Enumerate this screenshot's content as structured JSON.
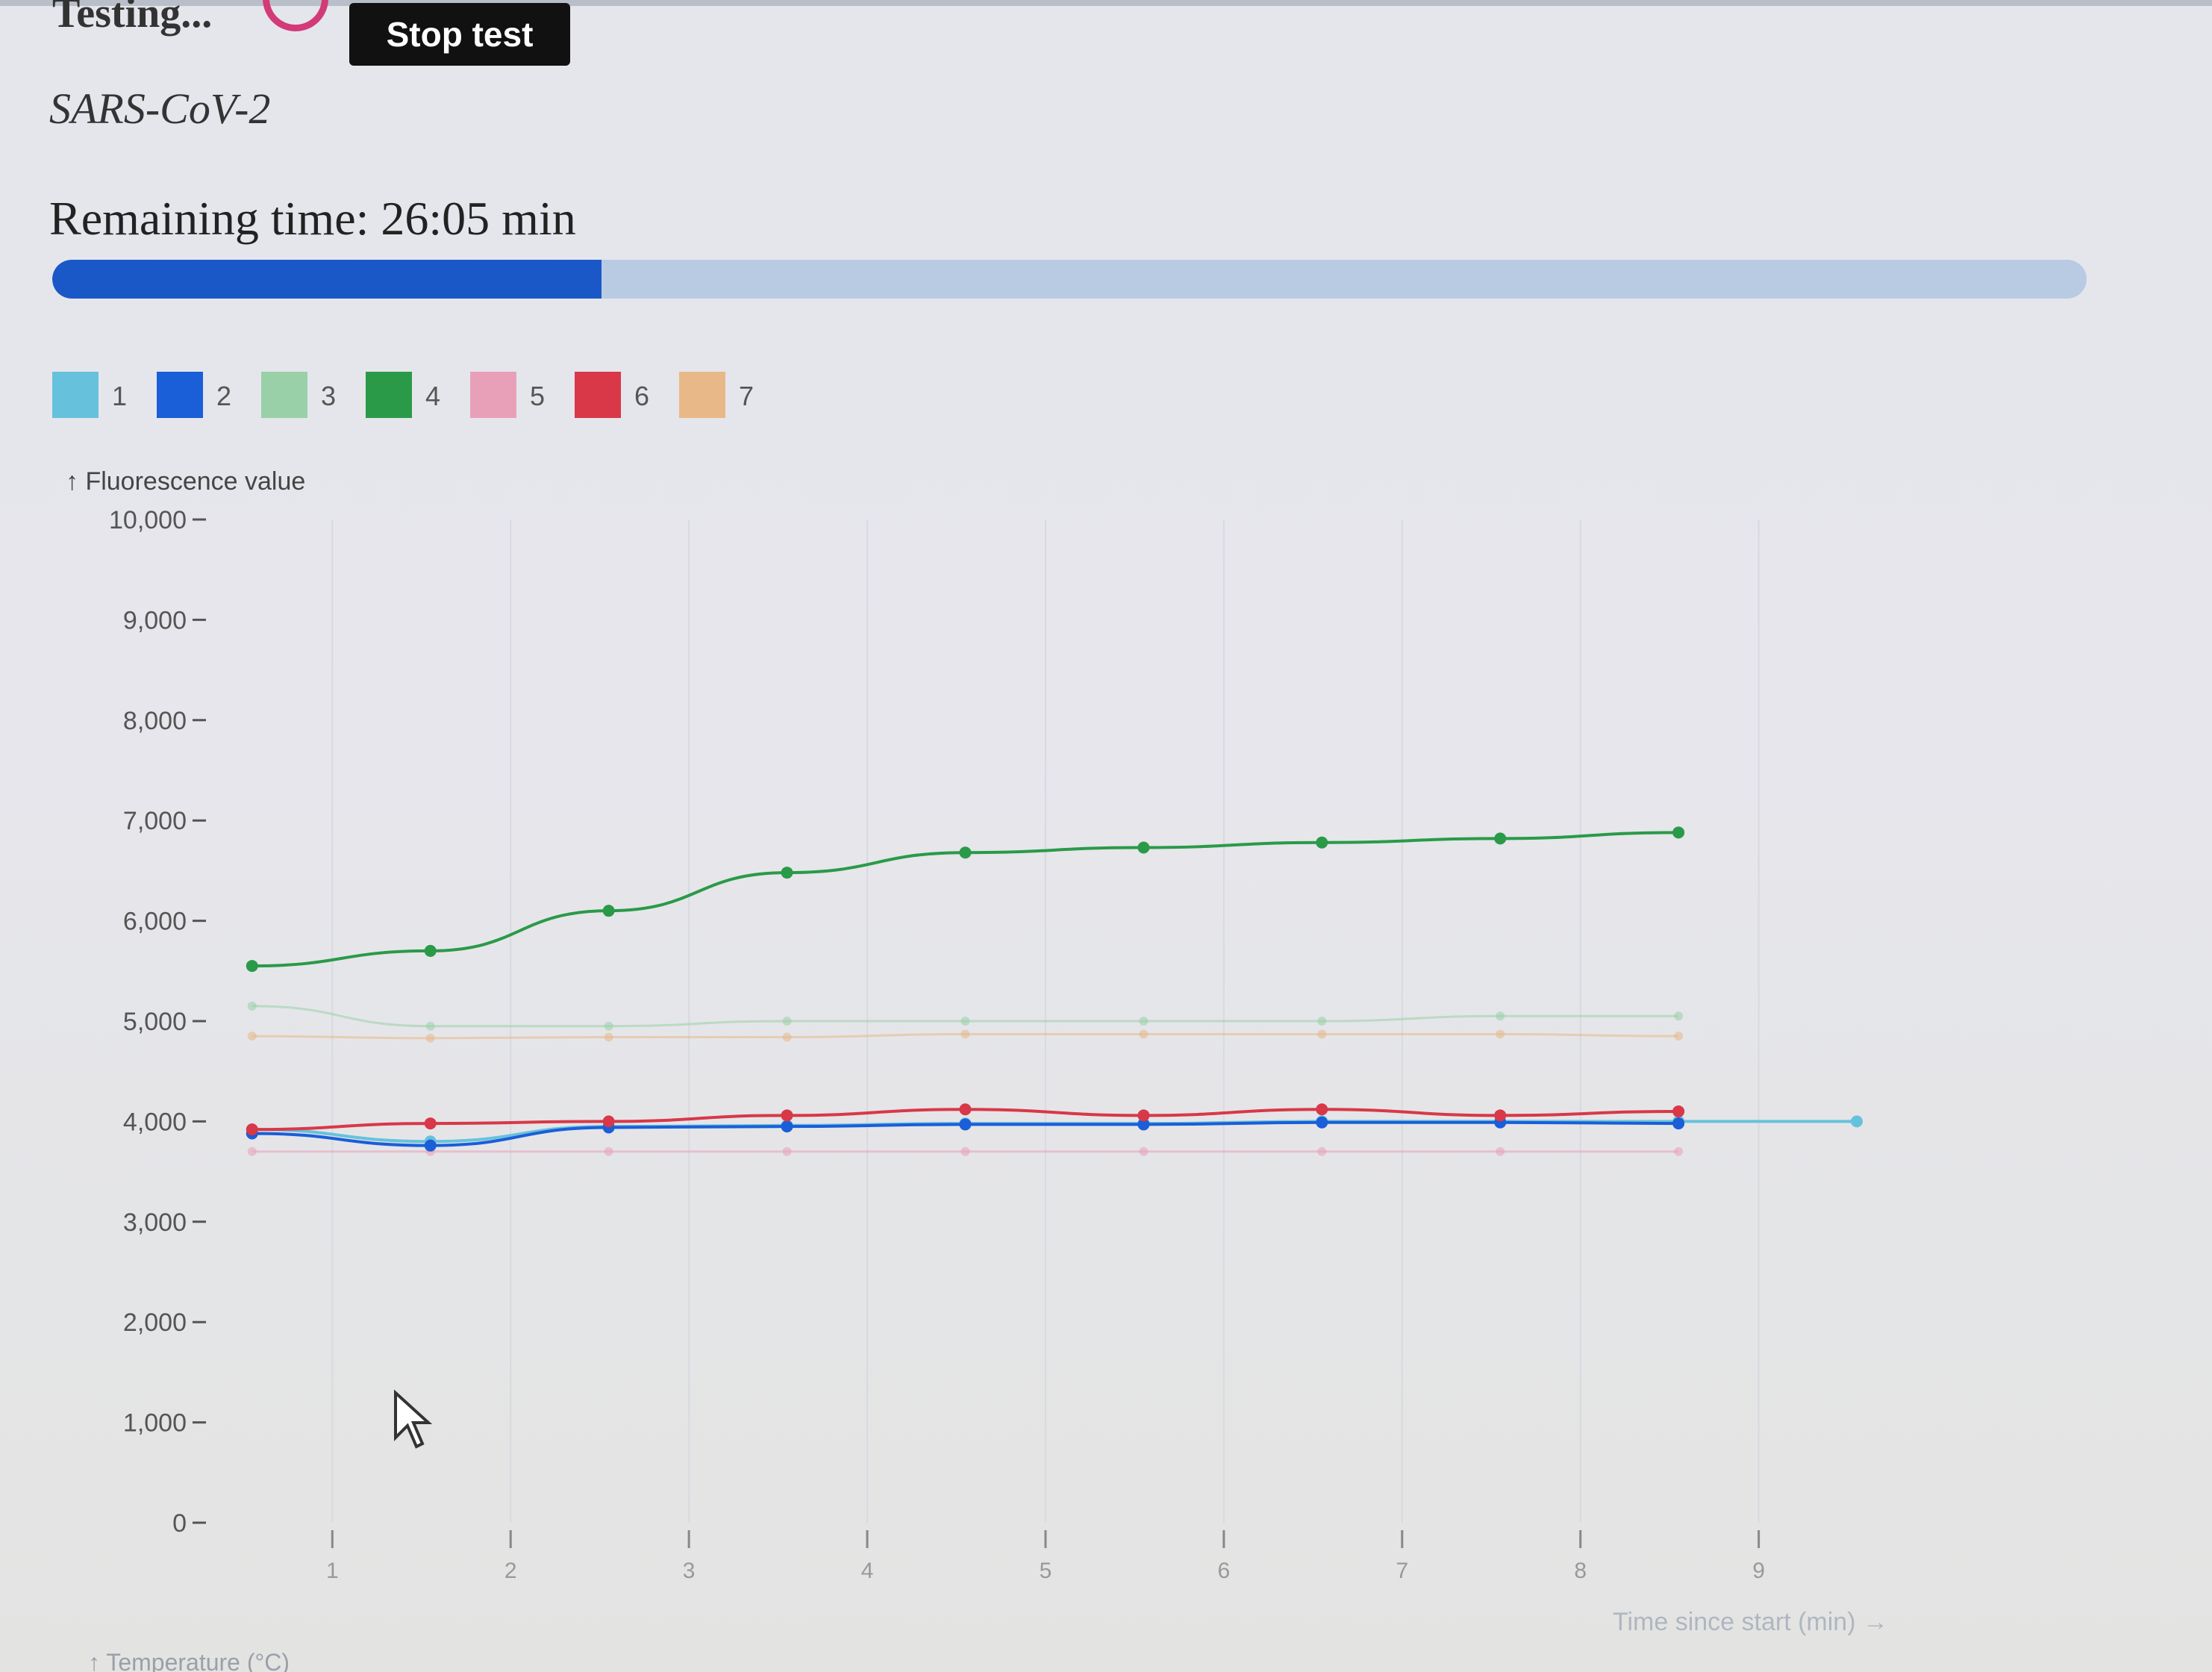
{
  "header": {
    "status_text": "Testing...",
    "stop_button_label": "Stop test"
  },
  "test": {
    "name": "SARS-CoV-2",
    "remaining_label": "Remaining time:",
    "remaining_value": "26:05",
    "remaining_unit": "min",
    "remaining_text": "Remaining time: 26:05 min",
    "progress_fraction": 0.27
  },
  "colors": {
    "progress_fill": "#1a58c8",
    "progress_track": "#b9cbe2"
  },
  "chart_data": {
    "type": "line",
    "title": "",
    "ylabel": "↑ Fluorescence value",
    "xlabel": "Time since start (min) →",
    "secondary_label": "↑ Temperature (°C)",
    "ylim": [
      0,
      10000
    ],
    "yticks": [
      0,
      1000,
      2000,
      3000,
      4000,
      5000,
      6000,
      7000,
      8000,
      9000,
      10000
    ],
    "ytick_labels": [
      "0",
      "1,000",
      "2,000",
      "3,000",
      "4,000",
      "5,000",
      "6,000",
      "7,000",
      "8,000",
      "9,000",
      "10,000"
    ],
    "xlim": [
      0.35,
      9.6
    ],
    "xticks": [
      1,
      2,
      3,
      4,
      5,
      6,
      7,
      8,
      9
    ],
    "xtick_labels": [
      "1",
      "2",
      "3",
      "4",
      "5",
      "6",
      "7",
      "8",
      "9"
    ],
    "grid": "vertical",
    "legend_position": "top-left",
    "series": [
      {
        "name": "1",
        "color": "#66c2dc",
        "faded": false,
        "x": [
          0.55,
          1.55,
          2.55,
          3.55,
          4.55,
          5.55,
          6.55,
          7.55,
          8.55,
          9.55
        ],
        "values": [
          3920,
          3800,
          3950,
          3960,
          3980,
          3980,
          4000,
          4000,
          4000,
          4000
        ]
      },
      {
        "name": "2",
        "color": "#1a5ed8",
        "faded": false,
        "x": [
          0.55,
          1.55,
          2.55,
          3.55,
          4.55,
          5.55,
          6.55,
          7.55,
          8.55
        ],
        "values": [
          3880,
          3760,
          3940,
          3950,
          3970,
          3970,
          3990,
          3990,
          3980
        ]
      },
      {
        "name": "3",
        "color": "#99d0a8",
        "faded": true,
        "x": [
          0.55,
          1.55,
          2.55,
          3.55,
          4.55,
          5.55,
          6.55,
          7.55,
          8.55
        ],
        "values": [
          5150,
          4950,
          4950,
          5000,
          5000,
          5000,
          5000,
          5050,
          5050
        ]
      },
      {
        "name": "4",
        "color": "#2a9a48",
        "faded": false,
        "x": [
          0.55,
          1.55,
          2.55,
          3.55,
          4.55,
          5.55,
          6.55,
          7.55,
          8.55
        ],
        "values": [
          5550,
          5700,
          6100,
          6480,
          6680,
          6730,
          6780,
          6820,
          6880
        ]
      },
      {
        "name": "5",
        "color": "#e8a0b8",
        "faded": true,
        "x": [
          0.55,
          1.55,
          2.55,
          3.55,
          4.55,
          5.55,
          6.55,
          7.55,
          8.55
        ],
        "values": [
          3700,
          3700,
          3700,
          3700,
          3700,
          3700,
          3700,
          3700,
          3700
        ]
      },
      {
        "name": "6",
        "color": "#d83848",
        "faded": false,
        "x": [
          0.55,
          1.55,
          2.55,
          3.55,
          4.55,
          5.55,
          6.55,
          7.55,
          8.55
        ],
        "values": [
          3920,
          3980,
          4000,
          4060,
          4120,
          4060,
          4120,
          4060,
          4100
        ]
      },
      {
        "name": "7",
        "color": "#e8b888",
        "faded": true,
        "x": [
          0.55,
          1.55,
          2.55,
          3.55,
          4.55,
          5.55,
          6.55,
          7.55,
          8.55
        ],
        "values": [
          4850,
          4830,
          4840,
          4840,
          4870,
          4870,
          4870,
          4870,
          4850
        ]
      }
    ]
  }
}
